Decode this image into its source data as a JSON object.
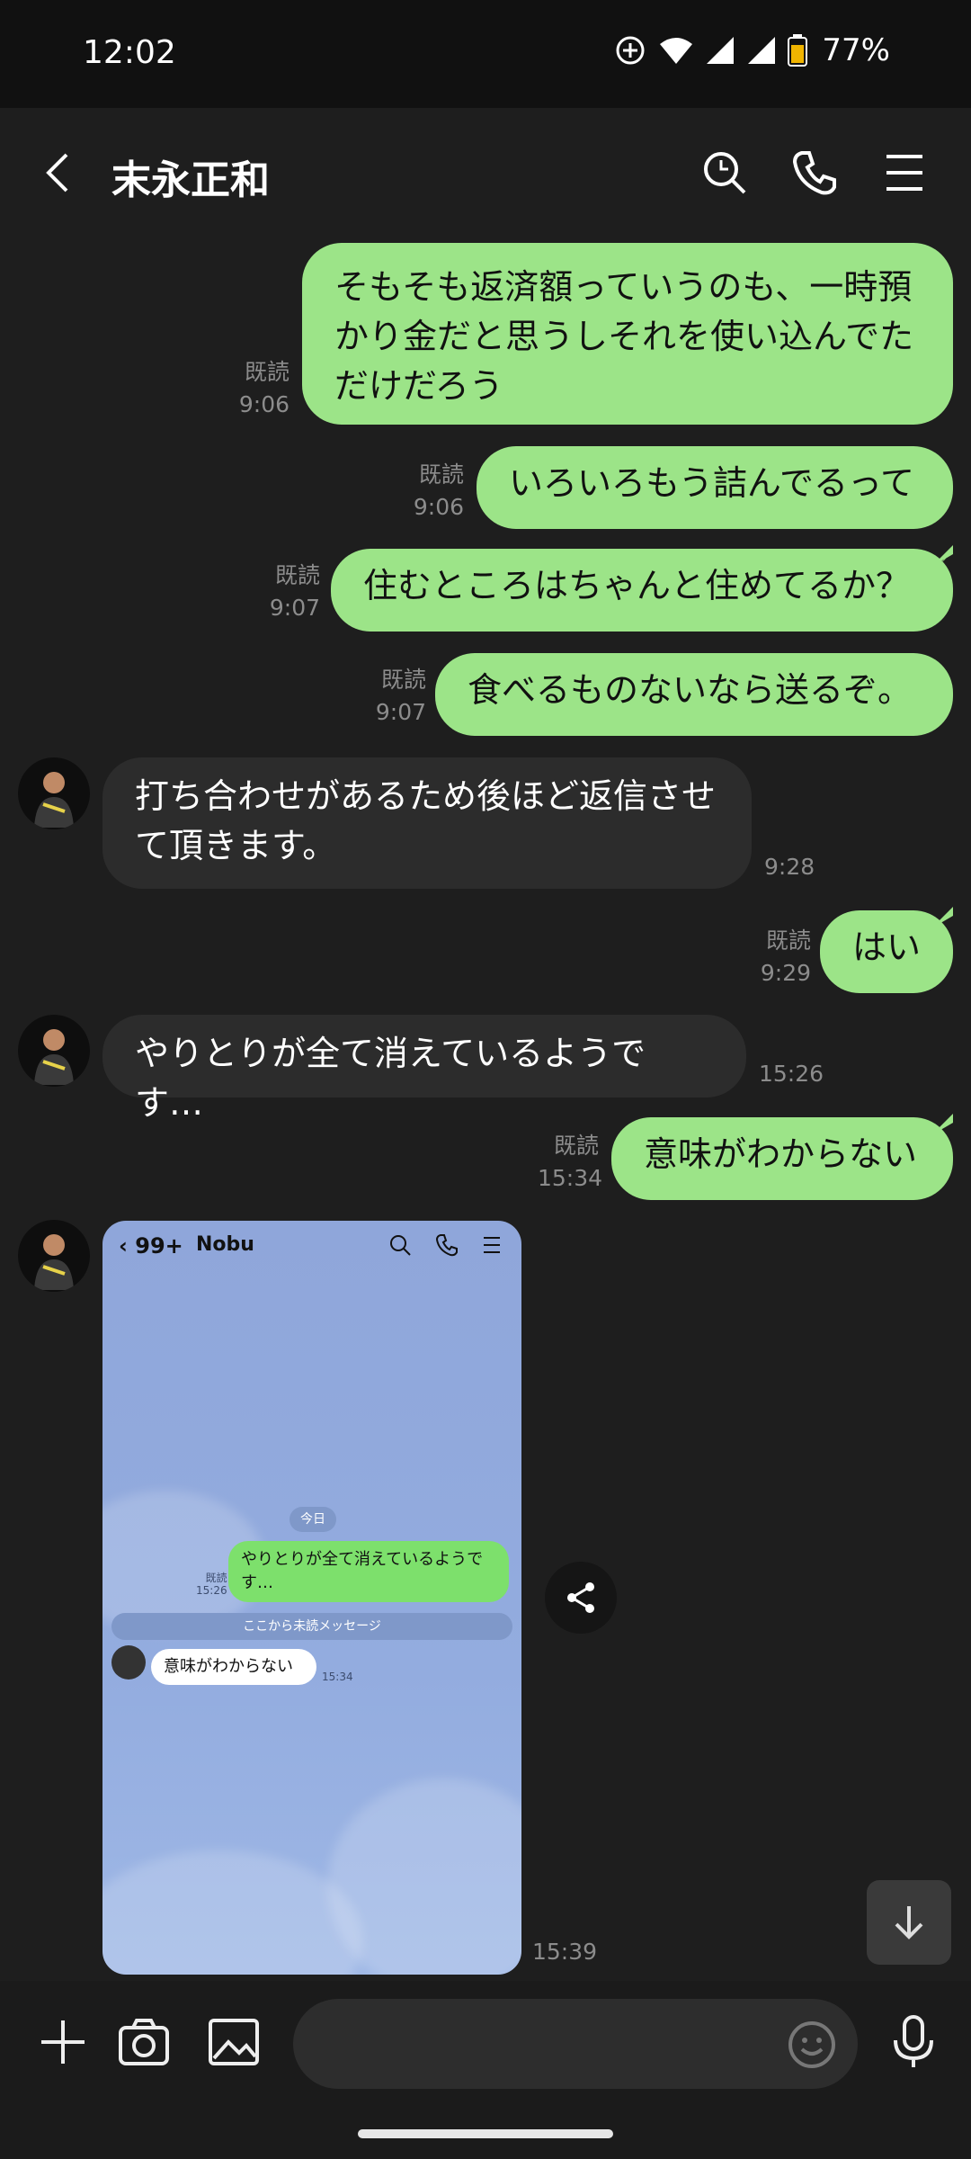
{
  "status_bar": {
    "time": "12:02",
    "battery": "77%"
  },
  "header": {
    "title": "末永正和"
  },
  "messages": [
    {
      "dir": "out",
      "text": "そもそも返済額っていうのも、一時預かり金だと思うしそれを使い込んでただけだろう",
      "read": "既読",
      "time": "9:06"
    },
    {
      "dir": "out",
      "text": "いろいろもう詰んでるって",
      "read": "既読",
      "time": "9:06"
    },
    {
      "dir": "out",
      "text": "住むところはちゃんと住めてるか？",
      "read": "既読",
      "time": "9:07"
    },
    {
      "dir": "out",
      "text": "食べるものないなら送るぞ。",
      "read": "既読",
      "time": "9:07"
    },
    {
      "dir": "in",
      "text": "打ち合わせがあるため後ほど返信させて頂きます。",
      "time": "9:28"
    },
    {
      "dir": "out",
      "text": "はい",
      "read": "既読",
      "time": "9:29"
    },
    {
      "dir": "in",
      "text": "やりとりが全て消えているようです…",
      "time": "15:26"
    },
    {
      "dir": "out",
      "text": "意味がわからない",
      "read": "既読",
      "time": "15:34"
    },
    {
      "dir": "in",
      "type": "image",
      "time": "15:39"
    }
  ],
  "screenshot": {
    "back_count": "99+",
    "name": "Nobu",
    "date_label": "今日",
    "out_text": "やりとりが全て消えているようです…",
    "out_read": "既読",
    "out_time": "15:26",
    "unread_label": "ここから未読メッセージ",
    "in_text": "意味がわからない",
    "in_time": "15:34"
  },
  "input": {
    "placeholder": ""
  },
  "colors": {
    "outgoing_bubble": "#9ce488",
    "incoming_bubble": "#2c2c2c",
    "background": "#1e1e1e"
  }
}
